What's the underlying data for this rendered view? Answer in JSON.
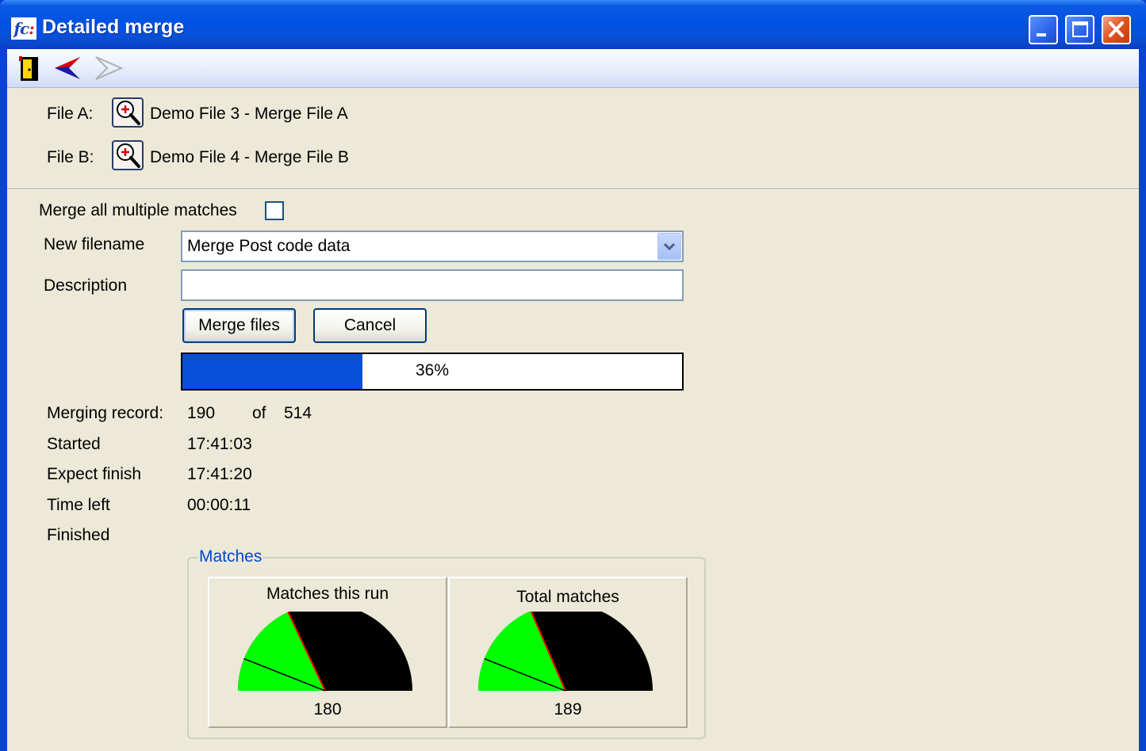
{
  "window": {
    "title": "Detailed merge",
    "icon": "fc-app-icon",
    "controls": [
      "minimize",
      "maximize",
      "close"
    ]
  },
  "toolbar": {
    "items": [
      "exit-icon",
      "back-arrow-icon",
      "forward-arrow-icon"
    ]
  },
  "files": {
    "a_label": "File A:",
    "a_name": "Demo File 3 - Merge File A",
    "b_label": "File B:",
    "b_name": "Demo File 4 - Merge File B"
  },
  "options": {
    "merge_all_label": "Merge all multiple matches",
    "merge_all_checked": false,
    "new_filename_label": "New filename",
    "new_filename_value": "Merge Post code data",
    "description_label": "Description",
    "description_value": ""
  },
  "buttons": {
    "merge_label": "Merge files",
    "cancel_label": "Cancel"
  },
  "progress": {
    "percent": 36,
    "text": "36%"
  },
  "status": {
    "merging_label": "Merging record:",
    "current": "190",
    "of_label": "of",
    "total": "514",
    "started_label": "Started",
    "started_value": "17:41:03",
    "expect_label": "Expect finish",
    "expect_value": "17:41:20",
    "timeleft_label": "Time left",
    "timeleft_value": "00:00:11",
    "finished_label": "Finished",
    "finished_value": ""
  },
  "matches": {
    "group_title": "Matches",
    "gauges": [
      {
        "title": "Matches this run",
        "value": "180",
        "green_fraction": 0.36
      },
      {
        "title": "Total matches",
        "value": "189",
        "green_fraction": 0.37
      }
    ]
  },
  "colors": {
    "titlebar": "#0052e3",
    "progress_fill": "#0a4fd8",
    "gauge_green": "#00ff00",
    "gauge_black": "#000000",
    "needle": "#ff0000",
    "group_title": "#0046d5"
  }
}
